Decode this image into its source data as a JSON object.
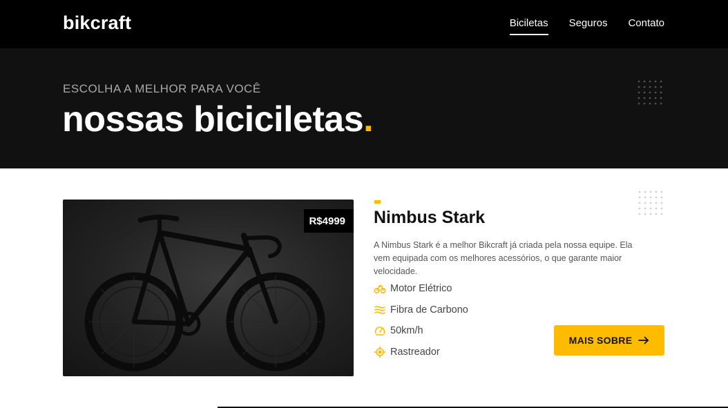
{
  "header": {
    "logo": "bikcraft",
    "nav": [
      {
        "label": "Biciletas",
        "active": true
      },
      {
        "label": "Seguros",
        "active": false
      },
      {
        "label": "Contato",
        "active": false
      }
    ]
  },
  "hero": {
    "eyebrow": "ESCOLHA A MELHOR PARA VOCÊ",
    "title": "nossas biciciletas",
    "title_dot": "."
  },
  "product": {
    "price": "R$4999",
    "name": "Nimbus Stark",
    "description": "A Nimbus Stark é a melhor Bikcraft já criada pela nossa equipe. Ela vem equipada com os melhores acessórios, o que garante maior velocidade.",
    "features": [
      {
        "icon": "motor-icon",
        "label": "Motor Elétrico"
      },
      {
        "icon": "carbon-fiber-icon",
        "label": "Fibra de Carbono"
      },
      {
        "icon": "speedometer-icon",
        "label": "50km/h"
      },
      {
        "icon": "tracker-icon",
        "label": "Rastreador"
      }
    ],
    "cta_label": "MAIS SOBRE",
    "cta_icon": "arrow-right-icon"
  },
  "colors": {
    "accent": "#FFBB00",
    "header_bg": "#000000",
    "hero_bg": "#111111"
  }
}
